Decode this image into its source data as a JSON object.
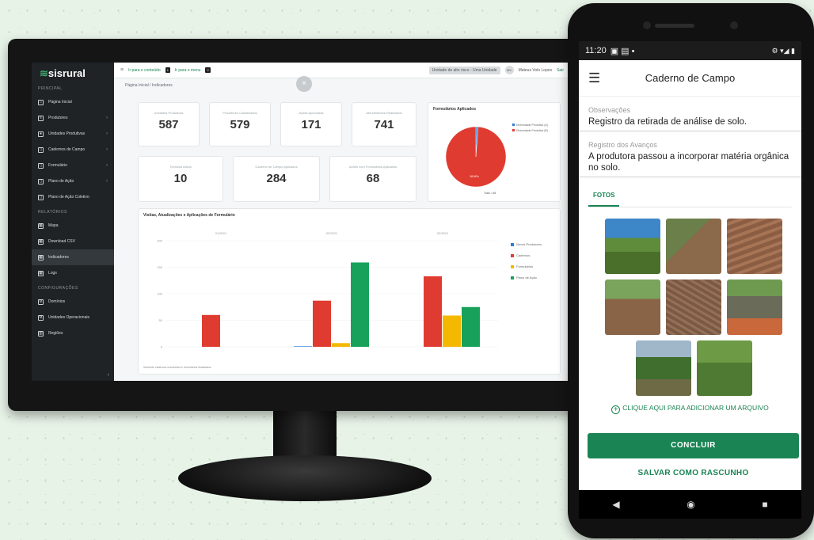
{
  "desktop": {
    "logo": "sisrural",
    "sections": [
      {
        "title": "PRINCIPAL",
        "items": [
          {
            "label": "Página Inicial",
            "icon": "home-icon"
          },
          {
            "label": "Produtores",
            "icon": "list-icon"
          },
          {
            "label": "Unidades Produtivas",
            "icon": "pin-icon"
          },
          {
            "label": "Cadernos de Campo",
            "icon": "book-icon"
          },
          {
            "label": "Formulário",
            "icon": "form-icon"
          },
          {
            "label": "Plano de Ação",
            "icon": "plan-icon"
          },
          {
            "label": "Plano de Ação Coletivo",
            "icon": "plan-icon"
          }
        ]
      },
      {
        "title": "RELATÓRIOS",
        "items": [
          {
            "label": "Mapa",
            "icon": "map-icon"
          },
          {
            "label": "Download CSV",
            "icon": "download-icon"
          },
          {
            "label": "Indicadores",
            "icon": "chart-icon"
          },
          {
            "label": "Logs",
            "icon": "log-icon"
          }
        ]
      },
      {
        "title": "CONFIGURAÇÕES",
        "items": [
          {
            "label": "Domínios",
            "icon": "gear-icon"
          },
          {
            "label": "Unidades Operacionais",
            "icon": "gear-icon"
          },
          {
            "label": "Regiões",
            "icon": "region-icon"
          }
        ]
      }
    ],
    "topbar": {
      "link1": "Ir para o conteúdo",
      "key1": "1",
      "link2": "Ir para o menu",
      "key2": "2",
      "select": "Unidade de alto risco - Uma Unidade",
      "avatar": "MV",
      "user": "Mateus Volo Lopes",
      "logout": "Sair"
    },
    "breadcrumb": "Página Inicial / Indicadores",
    "close_label": "×",
    "stats_row1": [
      {
        "label": "Unidades Produtivas",
        "value": "587"
      },
      {
        "label": "Produtores Cadastrados",
        "value": "579"
      },
      {
        "label": "Ações Aprovadas",
        "value": "171"
      },
      {
        "label": "Atendimentos Realizados",
        "value": "741"
      }
    ],
    "stats_row2": [
      {
        "label": "Técnicos Ativos",
        "value": "10"
      },
      {
        "label": "Caderno de Campo Aplicados",
        "value": "284"
      },
      {
        "label": "Ações com Formulários Aplicados",
        "value": "68"
      }
    ],
    "pie": {
      "title": "Formulários Aplicados",
      "center_label": "98.8%",
      "footer": "Total = 68",
      "legend": [
        {
          "label": "Diversidade Produtiva (A)",
          "color": "#2c7ed6"
        },
        {
          "label": "Diversidade Produtiva (B)",
          "color": "#e03b30"
        }
      ]
    },
    "bar_chart": {
      "title": "Visitas, Atualizações e Aplicações de Formulário",
      "note": "Somente cadernos concluídos e formulários finalizados"
    }
  },
  "chart_data": [
    {
      "type": "pie",
      "title": "Formulários Aplicados",
      "labels": [
        "Diversidade Produtiva (A)",
        "Diversidade Produtiva (B)"
      ],
      "values": [
        1.2,
        98.8
      ],
      "colors": [
        "#2c7ed6",
        "#e03b30"
      ]
    },
    {
      "type": "bar",
      "title": "Visitas, Atualizações e Aplicações de Formulário",
      "categories": [
        "01/2021",
        "02/2021",
        "03/2021"
      ],
      "ylim": [
        0,
        200
      ],
      "yticks": [
        0,
        50,
        100,
        150,
        200
      ],
      "series": [
        {
          "name": "Novos Produtores",
          "color": "#2c7ed6",
          "values": [
            0,
            1,
            0
          ]
        },
        {
          "name": "Cadernos",
          "color": "#e03b30",
          "values": [
            60,
            87,
            133
          ]
        },
        {
          "name": "Formulários",
          "color": "#f5b800",
          "values": [
            0,
            7,
            59
          ]
        },
        {
          "name": "Plano de Ação",
          "color": "#18a15b",
          "values": [
            0,
            159,
            75
          ]
        }
      ]
    }
  ],
  "phone": {
    "time": "11:20",
    "status_right": "⚙ ▾◢ ▮",
    "title": "Caderno de Campo",
    "fields": [
      {
        "label": "Observações",
        "value": "Registro da retirada de análise de solo."
      },
      {
        "label": "Registro dos Avanços",
        "value": "A produtora passou a incorporar matéria orgânica no solo."
      }
    ],
    "tab": "FOTOS",
    "add_file": "CLIQUE AQUI PARA ADICIONAR UM ARQUIVO",
    "primary_button": "CONCLUIR",
    "secondary_button": "SALVAR COMO RASCUNHO"
  }
}
